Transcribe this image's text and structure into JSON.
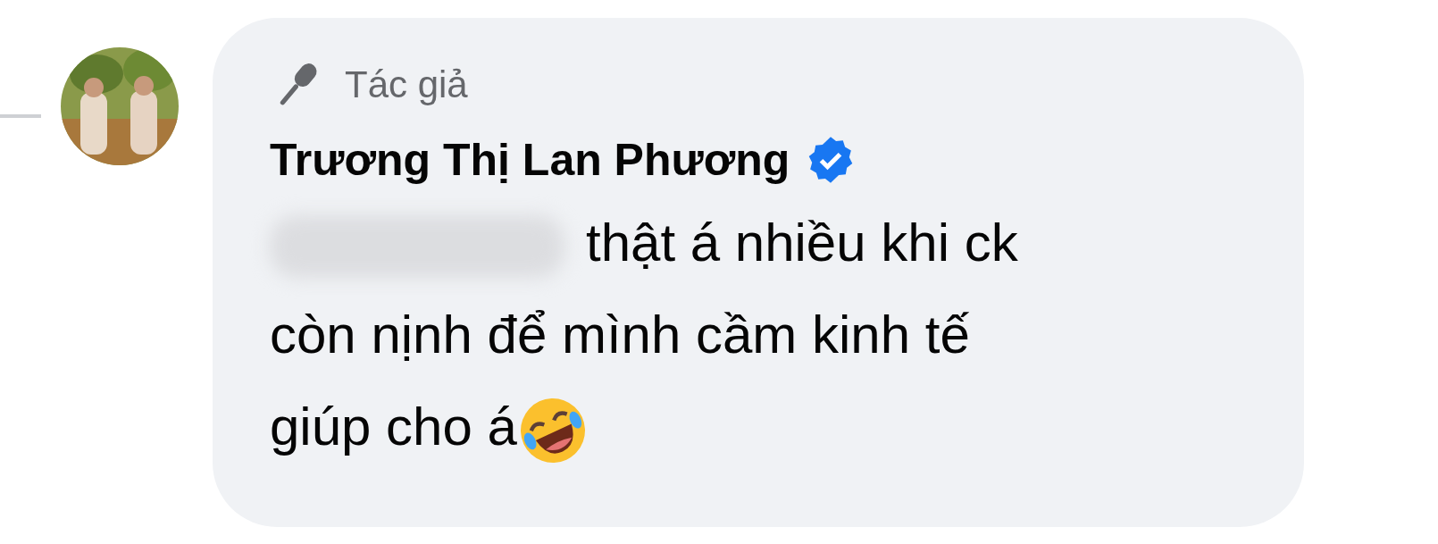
{
  "comment": {
    "badge": "Tác giả",
    "author": "Trương Thị Lan Phương",
    "verified": true,
    "mention_blurred": true,
    "lines": [
      "thật á nhiều khi ck",
      "còn nịnh để mình cầm kinh tế",
      "giúp cho á"
    ]
  }
}
